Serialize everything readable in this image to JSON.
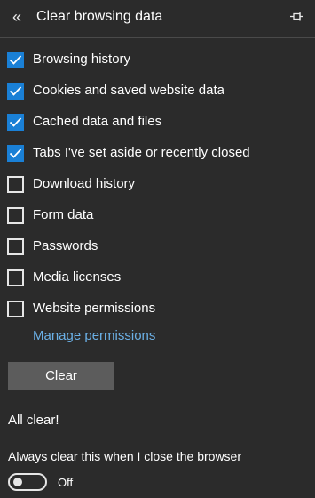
{
  "header": {
    "title": "Clear browsing data",
    "back_icon": "double-chevron-left-icon",
    "pin_icon": "pin-icon"
  },
  "options": [
    {
      "label": "Browsing history",
      "checked": true
    },
    {
      "label": "Cookies and saved website data",
      "checked": true
    },
    {
      "label": "Cached data and files",
      "checked": true
    },
    {
      "label": "Tabs I've set aside or recently closed",
      "checked": true
    },
    {
      "label": "Download history",
      "checked": false
    },
    {
      "label": "Form data",
      "checked": false
    },
    {
      "label": "Passwords",
      "checked": false
    },
    {
      "label": "Media licenses",
      "checked": false
    },
    {
      "label": "Website permissions",
      "checked": false
    }
  ],
  "manage_permissions_link": "Manage permissions",
  "clear_button": "Clear",
  "status_text": "All clear!",
  "always_clear": {
    "label": "Always clear this when I close the browser",
    "toggle_state": "Off",
    "enabled": false
  },
  "colors": {
    "background": "#2b2b2b",
    "accent": "#1a80d6",
    "link": "#6bb0e6",
    "button": "#5c5c5c"
  }
}
